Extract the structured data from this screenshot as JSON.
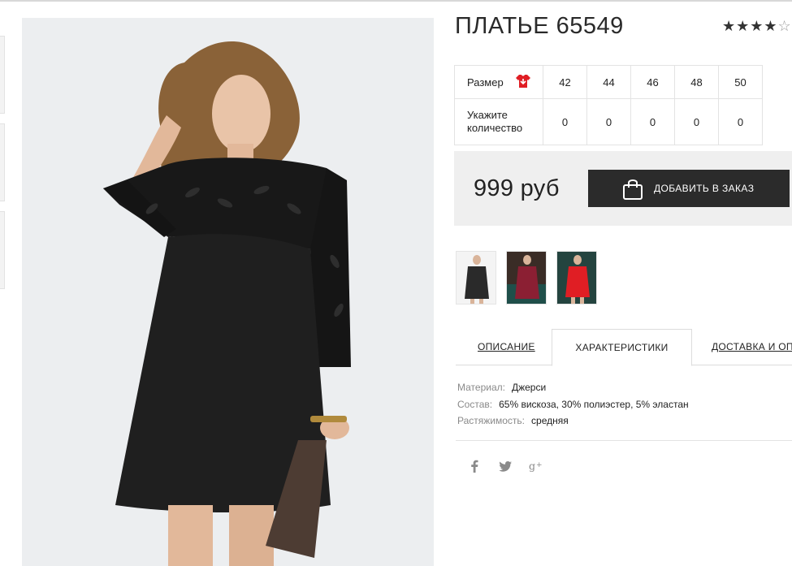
{
  "product": {
    "title": "ПЛАТЬЕ 65549",
    "rating": {
      "value": 4,
      "max": 5,
      "stars_filled": "★★★★",
      "stars_empty": "☆"
    }
  },
  "sizes": {
    "label": "Размер",
    "size_chart_icon": "red-shirt-size-icon",
    "values": [
      "42",
      "44",
      "46",
      "48",
      "50"
    ],
    "quantity_label": "Укажите количество",
    "quantities": [
      "0",
      "0",
      "0",
      "0",
      "0"
    ]
  },
  "purchase": {
    "price": "999 руб",
    "button_label": "ДОБАВИТЬ В ЗАКАЗ",
    "button_icon": "shopping-bag-icon"
  },
  "color_variants": [
    {
      "name": "black",
      "color": "#2a2a2a"
    },
    {
      "name": "burgundy",
      "color": "#8b1f33"
    },
    {
      "name": "red",
      "color": "#e01e24"
    }
  ],
  "tabs": {
    "description": "ОПИСАНИЕ",
    "characteristics": "ХАРАКТЕРИСТИКИ",
    "delivery": "ДОСТАВКА И ОПЛАТА",
    "active": "characteristics"
  },
  "specs": [
    {
      "key": "Материал:",
      "value": "Джерси"
    },
    {
      "key": "Состав:",
      "value": "65% вискоза, 30% полиэстер, 5% эластан"
    },
    {
      "key": "Растяжимость:",
      "value": "средняя"
    }
  ],
  "social": [
    "facebook-icon",
    "twitter-icon",
    "google-plus-icon"
  ],
  "colors": {
    "accent_dark": "#2b2b2b",
    "price_bg": "#efefef",
    "size_icon_red": "#e01e24"
  }
}
